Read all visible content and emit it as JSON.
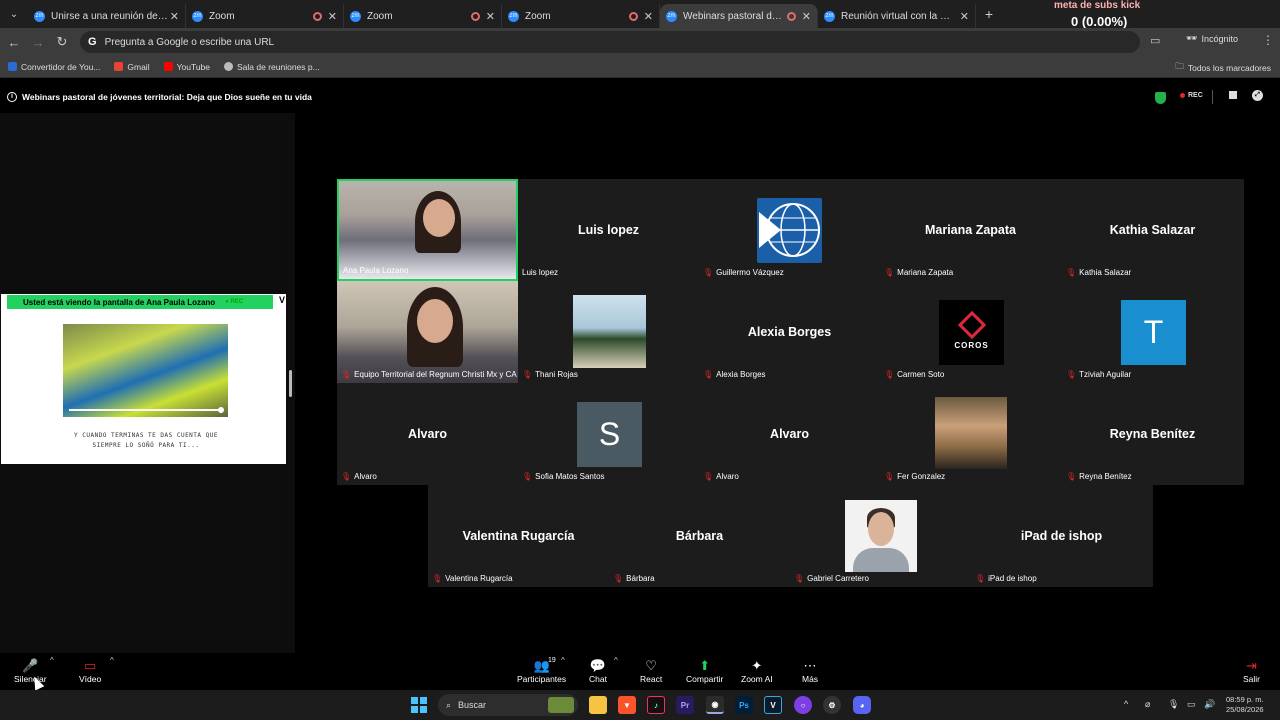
{
  "browser": {
    "tabs": [
      {
        "label": "Unirse a una reunión de Zoom",
        "favicon": "zm"
      },
      {
        "label": "Zoom",
        "favicon": "zm"
      },
      {
        "label": "Zoom",
        "favicon": "zm"
      },
      {
        "label": "Zoom",
        "favicon": "zm"
      },
      {
        "label": "Webinars pastoral de jóvenes",
        "favicon": "zm"
      },
      {
        "label": "Reunión virtual con la Comunic",
        "favicon": "zm"
      }
    ],
    "omnibox": {
      "icon": "G",
      "placeholder": "Pregunta a Google o escribe una URL"
    },
    "incognito_label": "Incógnito",
    "bookmarks": [
      {
        "label": "Convertidor de You...",
        "color": "#2b6bd6"
      },
      {
        "label": "Gmail",
        "color": "#ea4335"
      },
      {
        "label": "YouTube",
        "color": "#ff0000"
      },
      {
        "label": "Sala de reuniones p...",
        "color": "#bbbbbb"
      }
    ],
    "all_bookmarks": "Todos los marcadores"
  },
  "stream_overlay": {
    "kick_label": "meta de subs kick",
    "count": "0 (0.00%)",
    "zero": "0"
  },
  "meeting": {
    "title": "Webinars pastoral de jóvenes territorial: Deja que Dios sueñe en tu vida",
    "rec_label": "REC"
  },
  "share": {
    "banner": "Usted está viendo la pantalla de  Ana Paula Lozano",
    "rec": "● REC",
    "view_btn": "V",
    "caption_line1": "Y CUANDO TERMINAS TE DAS CUENTA QUE",
    "caption_line2": "SIEMPRE LO SOÑÓ PARA TI..."
  },
  "participants": [
    {
      "name": "Ana Paula Lozano",
      "big": "",
      "muted": false
    },
    {
      "name": "Luis lopez",
      "big": "Luis lopez",
      "muted": false
    },
    {
      "name": "Guillermo Vázquez",
      "big": "",
      "muted": true
    },
    {
      "name": "Mariana Zapata",
      "big": "Mariana Zapata",
      "muted": true
    },
    {
      "name": "Kathia Salazar",
      "big": "Kathia Salazar",
      "muted": true
    },
    {
      "name": "Equipo Territorial del Regnum Christi Mx y CA",
      "big": "",
      "muted": true
    },
    {
      "name": "Thani Rojas",
      "big": "",
      "muted": true
    },
    {
      "name": "Alexia Borges",
      "big": "Alexia Borges",
      "muted": true
    },
    {
      "name": "Carmen Soto",
      "big": "",
      "muted": true
    },
    {
      "name": "Tziviah Aguilar",
      "big": "",
      "muted": true
    },
    {
      "name": "Alvaro",
      "big": "Alvaro",
      "muted": true
    },
    {
      "name": "Sofia Matos Santos",
      "big": "S",
      "muted": true
    },
    {
      "name": "Alvaro",
      "big": "Alvaro",
      "muted": true
    },
    {
      "name": "Fer Gonzalez",
      "big": "",
      "muted": true
    },
    {
      "name": "Reyna Benítez",
      "big": "Reyna Benítez",
      "muted": true
    },
    {
      "name": "Valentina Rugarcía",
      "big": "Valentina Rugarcía",
      "muted": true
    },
    {
      "name": "Bárbara",
      "big": "Bárbara",
      "muted": true
    },
    {
      "name": "Gabriel Carretero",
      "big": "",
      "muted": true
    },
    {
      "name": "iPad de ishop",
      "big": "iPad de ishop",
      "muted": true
    }
  ],
  "avatar_text": {
    "coros": "COROS",
    "tziviah": "T"
  },
  "toolbar": {
    "mute": "Silenciar",
    "video": "Vídeo",
    "participants": "Participantes",
    "participant_count": "19",
    "chat": "Chat",
    "react": "React",
    "share": "Compartir",
    "zoom_ai": "Zoom AI",
    "more": "Más",
    "leave": "Salir"
  },
  "taskbar": {
    "search": "Buscar",
    "time": "08:59 p. m.",
    "date": "25/08/2026"
  }
}
